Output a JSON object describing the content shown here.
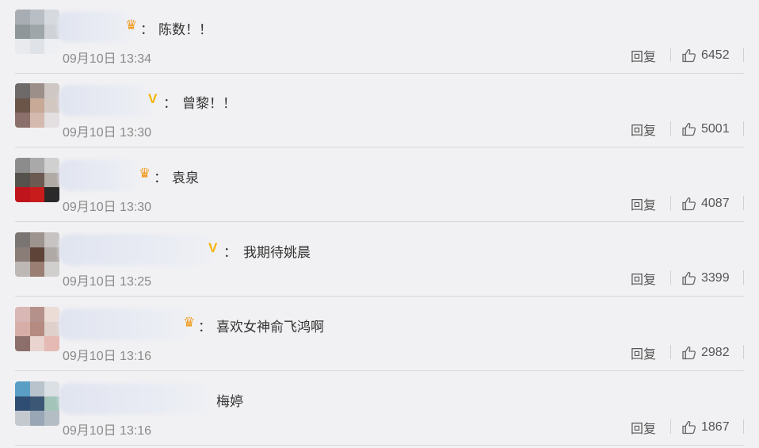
{
  "ui": {
    "reply_label": "回复"
  },
  "comments": [
    {
      "badge": "crown",
      "badge_glyph": "♛",
      "text": "陈数！！",
      "time": "09月10日 13:34",
      "likes": "6452",
      "avatar": [
        "#a7adb3",
        "#b9bec4",
        "#d6d9de",
        "#8e969a",
        "#9fa6a9",
        "#cfd3d7",
        "#e8eaed",
        "#dfe2e6",
        "#eeeff2"
      ]
    },
    {
      "badge": "v",
      "badge_glyph": "V",
      "text": "曾黎！！",
      "time": "09月10日 13:30",
      "likes": "5001",
      "avatar": [
        "#6e6a6a",
        "#9c8f89",
        "#cfc7c3",
        "#6b5548",
        "#c8a896",
        "#d2c7c1",
        "#8b6f6a",
        "#d3b9ae",
        "#e3dfe0"
      ]
    },
    {
      "badge": "crown",
      "badge_glyph": "♛",
      "text": "袁泉",
      "time": "09月10日 13:30",
      "likes": "4087",
      "avatar": [
        "#8c8c8c",
        "#a9a9a9",
        "#d0d0d0",
        "#55514c",
        "#6b5a52",
        "#b0a9a4",
        "#c0141c",
        "#c81c1c",
        "#2a2a2a"
      ]
    },
    {
      "badge": "v",
      "badge_glyph": "V",
      "text": "我期待姚晨",
      "time": "09月10日 13:25",
      "likes": "3399",
      "avatar": [
        "#7a7573",
        "#9e948f",
        "#c6c3c2",
        "#8a7d77",
        "#5d4338",
        "#b0aaa6",
        "#bdb7b5",
        "#9b7e73",
        "#d1cfce"
      ]
    },
    {
      "badge": "crown",
      "badge_glyph": "♛",
      "text": "喜欢女神俞飞鸿啊",
      "time": "09月10日 13:16",
      "likes": "2982",
      "avatar": [
        "#d8b7b4",
        "#b5918b",
        "#ecdcd6",
        "#d7aea7",
        "#b58b81",
        "#e0d0cb",
        "#8c6f6a",
        "#e9d4cf",
        "#e5b9b4"
      ]
    },
    {
      "badge": "none",
      "badge_glyph": "",
      "text": "梅婷",
      "time": "09月10日 13:16",
      "likes": "1867",
      "avatar": [
        "#5a9ec6",
        "#b9c3cb",
        "#dbe0e4",
        "#2f4d72",
        "#3c5775",
        "#a3c4b9",
        "#c4c9cf",
        "#98a6b5",
        "#b5bdc4"
      ]
    }
  ]
}
